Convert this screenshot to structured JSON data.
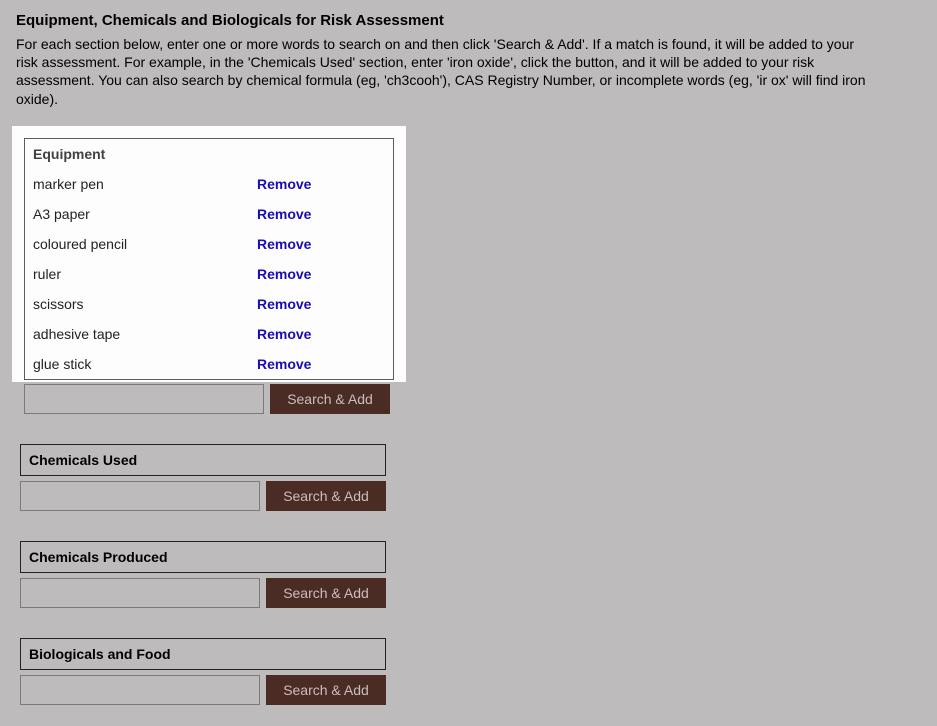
{
  "header": {
    "title": "Equipment, Chemicals and Biologicals for Risk Assessment",
    "intro": "For each section below, enter one or more words to search on and then click 'Search & Add'. If a match is found, it will be added to your risk assessment. For example, in the 'Chemicals Used' section, enter 'iron oxide', click the button, and it will be added to your risk assessment. You can also search by chemical formula (eg, 'ch3cooh'), CAS Registry Number, or incomplete words (eg, 'ir ox' will find iron oxide)."
  },
  "common": {
    "remove_label": "Remove",
    "search_button_label": "Search & Add"
  },
  "sections": {
    "equipment": {
      "title": "Equipment",
      "items": [
        {
          "name": "marker pen"
        },
        {
          "name": "A3 paper"
        },
        {
          "name": "coloured pencil"
        },
        {
          "name": "ruler"
        },
        {
          "name": "scissors"
        },
        {
          "name": "adhesive tape"
        },
        {
          "name": "glue stick"
        }
      ],
      "search_value": ""
    },
    "chemicals_used": {
      "title": "Chemicals Used",
      "search_value": ""
    },
    "chemicals_produced": {
      "title": "Chemicals Produced",
      "search_value": ""
    },
    "biologicals": {
      "title": "Biologicals and Food",
      "search_value": ""
    }
  }
}
